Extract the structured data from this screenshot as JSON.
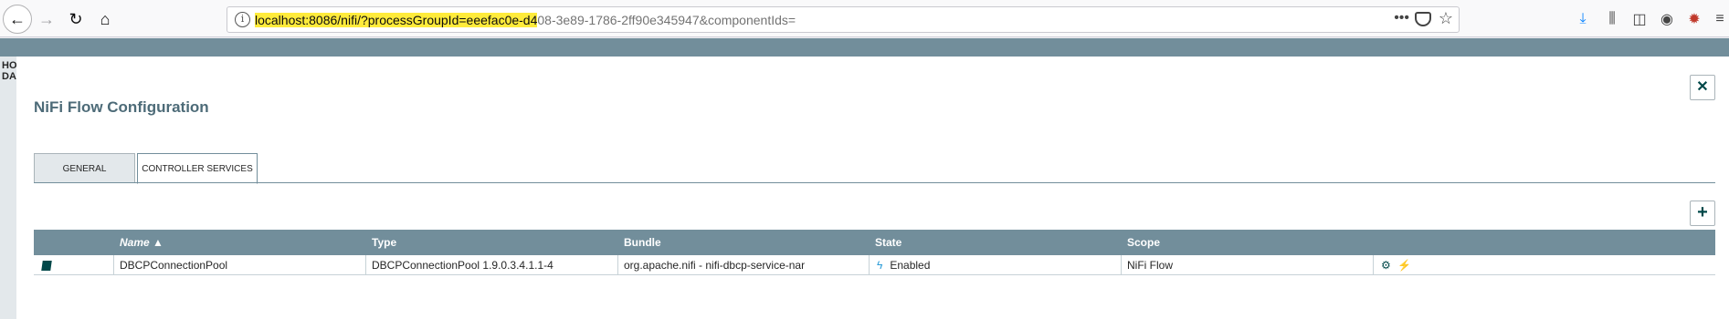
{
  "browser": {
    "url_highlighted": "localhost:8086/nifi/?processGroupId=eeefac0e-d4",
    "url_rest": "08-3e89-1786-2ff90e345947&componentIds=",
    "url_more": "•••",
    "icons": [
      "back-icon",
      "forward-icon",
      "reload-icon",
      "home-icon",
      "info-icon",
      "pocket-icon",
      "bookmark-star-icon",
      "download-icon",
      "library-icon",
      "sidebar-icon",
      "account-icon",
      "extension-icon"
    ]
  },
  "background_app": {
    "side_fragment_1": "HO",
    "side_fragment_2": "DA"
  },
  "dialog": {
    "title": "NiFi Flow Configuration",
    "close_glyph": "✕",
    "add_glyph": "+",
    "tabs": [
      {
        "label": "General",
        "active": false
      },
      {
        "label": "Controller Services",
        "active": true
      }
    ],
    "table": {
      "columns": [
        "Name ▲",
        "Type",
        "Bundle",
        "State",
        "Scope"
      ],
      "rows": [
        {
          "name": "DBCPConnectionPool",
          "type": "DBCPConnectionPool 1.9.0.3.4.1.1-4",
          "bundle": "org.apache.nifi - nifi-dbcp-service-nar",
          "state": "Enabled",
          "scope": "NiFi Flow"
        }
      ]
    }
  },
  "colors": {
    "header_bg": "#728e9b",
    "accent": "#004849",
    "title": "#4d6b78",
    "enabled_bolt": "#2b9cd8"
  }
}
